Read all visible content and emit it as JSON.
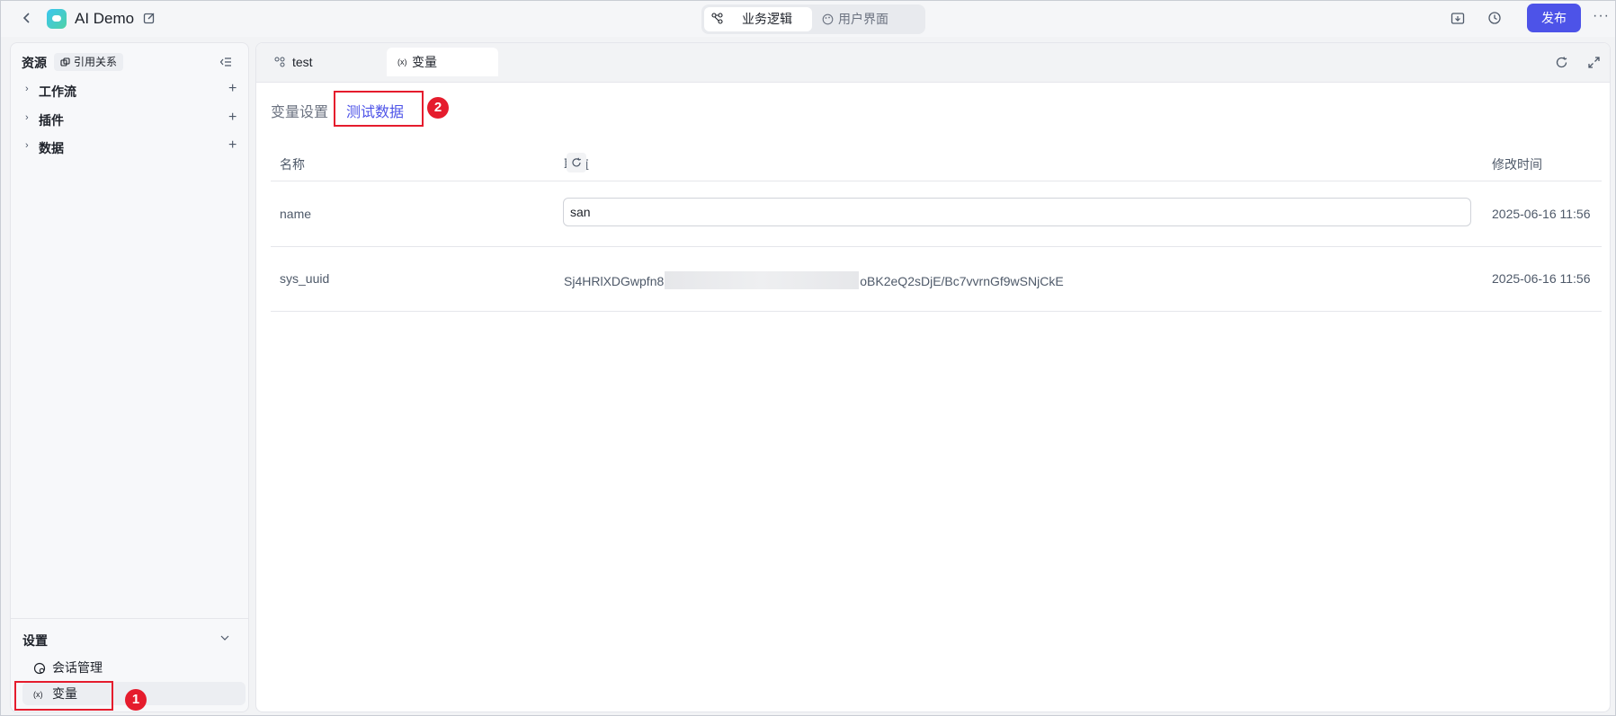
{
  "topbar": {
    "app_title": "AI Demo",
    "seg_active": "业务逻辑",
    "seg_inactive": "用户界面",
    "publish_label": "发布",
    "more": "···"
  },
  "sidebar": {
    "title": "资源",
    "ref_button": "引用关系",
    "tree": [
      {
        "label": "工作流"
      },
      {
        "label": "插件"
      },
      {
        "label": "数据"
      }
    ],
    "settings_title": "设置",
    "settings_items": [
      {
        "label": "会话管理"
      },
      {
        "label": "变量"
      }
    ]
  },
  "main": {
    "tabs": [
      {
        "label": "test"
      },
      {
        "label": "变量",
        "icon_text": "(x)"
      }
    ],
    "subtabs": {
      "inactive": "变量设置",
      "active": "测试数据"
    },
    "table": {
      "headers": [
        "名称",
        "取值",
        "修改时间"
      ],
      "rows": [
        {
          "name": "name",
          "value": "san",
          "time": "2025-06-16 11:56"
        },
        {
          "name": "sys_uuid",
          "value_start": "Sj4HRlXDGwpfn8",
          "value_end": "oBK2eQ2sDjE/Bc7vvrnGf9wSNjCkE",
          "time": "2025-06-16 11:56"
        }
      ]
    }
  },
  "annotations": {
    "badge1": "1",
    "badge2": "2"
  },
  "colors": {
    "accent": "#4d53e8",
    "annotation": "#e51c2d"
  }
}
